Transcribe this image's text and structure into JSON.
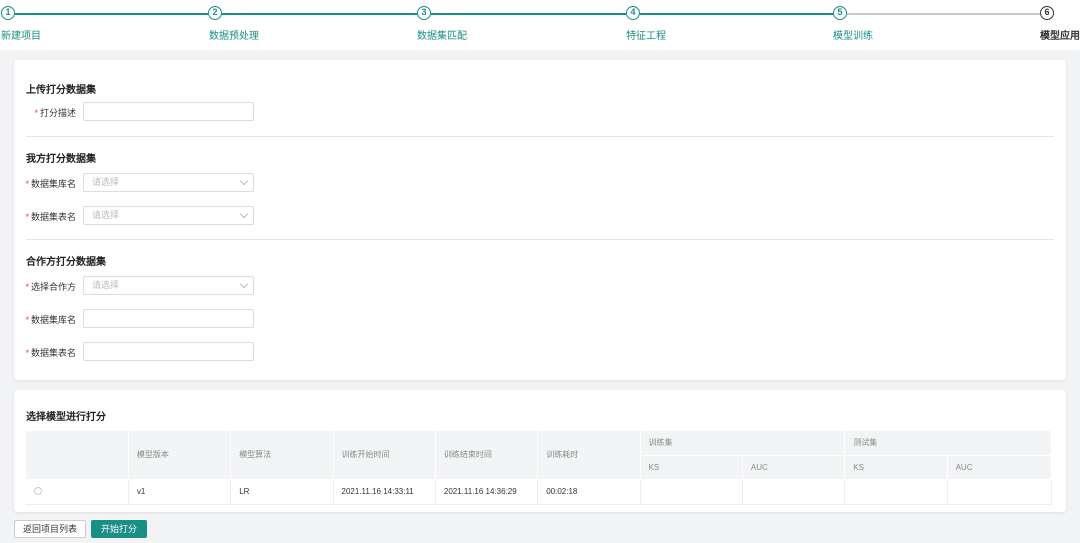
{
  "steps": [
    {
      "num": "1",
      "label": "新建项目"
    },
    {
      "num": "2",
      "label": "数据预处理"
    },
    {
      "num": "3",
      "label": "数据集匹配"
    },
    {
      "num": "4",
      "label": "特征工程"
    },
    {
      "num": "5",
      "label": "模型训练"
    },
    {
      "num": "6",
      "label": "模型应用"
    }
  ],
  "upload": {
    "title": "上传打分数据集",
    "desc_label": "打分描述",
    "desc_value": ""
  },
  "ours": {
    "title": "我方打分数据集",
    "db_label": "数据集库名",
    "db_placeholder": "请选择",
    "table_label": "数据集表名",
    "table_placeholder": "请选择"
  },
  "partner": {
    "title": "合作方打分数据集",
    "partner_label": "选择合作方",
    "partner_placeholder": "请选择",
    "db_label": "数据集库名",
    "table_label": "数据集表名"
  },
  "model_select": {
    "title": "选择模型进行打分",
    "headers": {
      "version": "模型版本",
      "algo": "模型算法",
      "start": "训练开始时间",
      "end": "训练结束时间",
      "duration": "训练耗时",
      "train_set": "训练集",
      "test_set": "测试集",
      "ks": "KS",
      "auc": "AUC"
    },
    "rows": [
      {
        "version": "v1",
        "algo": "LR",
        "start": "2021.11.16 14:33:11",
        "end": "2021.11.16 14:36:29",
        "duration": "00:02:18",
        "train_ks": "",
        "train_auc": "",
        "test_ks": "",
        "test_auc": ""
      }
    ]
  },
  "buttons": {
    "back": "返回项目列表",
    "start": "开始打分"
  },
  "colors": {
    "accent": "#1a8f86",
    "required": "#e54545"
  }
}
